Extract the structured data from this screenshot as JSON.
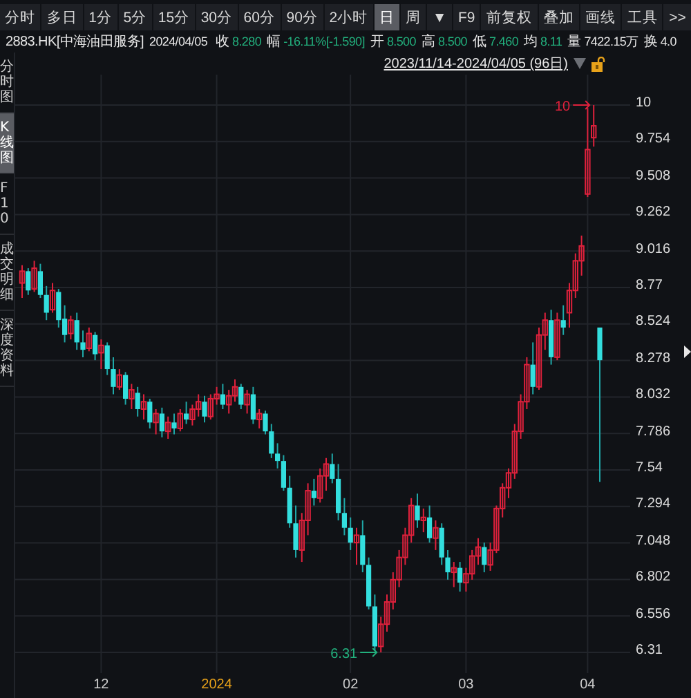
{
  "toolbar": {
    "periods": [
      {
        "label": "分时",
        "selected": false
      },
      {
        "label": "多日",
        "selected": false
      },
      {
        "label": "1分",
        "selected": false
      },
      {
        "label": "5分",
        "selected": false
      },
      {
        "label": "15分",
        "selected": false
      },
      {
        "label": "30分",
        "selected": false
      },
      {
        "label": "60分",
        "selected": false
      },
      {
        "label": "90分",
        "selected": false
      },
      {
        "label": "2小时",
        "selected": false
      },
      {
        "label": "日",
        "selected": true
      },
      {
        "label": "周",
        "selected": false
      }
    ],
    "dropdown": "▼",
    "tools": [
      "F9",
      "前复权",
      "叠加",
      "画线",
      "工具"
    ],
    "more": ">>"
  },
  "quote": {
    "symbol": "2883.HK[中海油田服务]",
    "date": "2024/04/05",
    "fields": [
      {
        "label": "收",
        "value": "8.280",
        "color": "#22b07d"
      },
      {
        "label": "幅",
        "value": "-16.11%[-1.590]",
        "color": "#22b07d"
      },
      {
        "label": "开",
        "value": "8.500",
        "color": "#22b07d"
      },
      {
        "label": "高",
        "value": "8.500",
        "color": "#22b07d"
      },
      {
        "label": "低",
        "value": "7.460",
        "color": "#22b07d"
      },
      {
        "label": "均",
        "value": "8.11",
        "color": "#22b07d"
      },
      {
        "label": "量",
        "value": "7422.15万",
        "color": "#e6e6e6"
      },
      {
        "label": "换",
        "value": "4.0",
        "color": "#e6e6e6"
      }
    ]
  },
  "sidebar": {
    "tabs": [
      {
        "label": "分时图",
        "selected": false
      },
      {
        "label": "K线图",
        "selected": true
      },
      {
        "label": "F10",
        "selected": false
      },
      {
        "label": "成交明细",
        "selected": false
      },
      {
        "label": "深度资料",
        "selected": false
      }
    ]
  },
  "chart": {
    "range": "2023/11/14-2024/04/05 (96日)",
    "tick_kinds": [
      {
        "kind": "month"
      },
      {
        "kind": "year"
      },
      {
        "kind": "month"
      },
      {
        "kind": "month"
      },
      {
        "kind": "month"
      }
    ],
    "high_marker": "10",
    "low_marker": "6.31",
    "chart_data": {
      "type": "candlestick",
      "categories": [
        null,
        null,
        null,
        null,
        null,
        null,
        null,
        null,
        null,
        null,
        null,
        null,
        null,
        "12",
        null,
        null,
        null,
        null,
        null,
        null,
        null,
        null,
        null,
        null,
        null,
        null,
        null,
        null,
        null,
        null,
        null,
        null,
        "2024",
        null,
        null,
        null,
        null,
        null,
        null,
        null,
        null,
        null,
        null,
        null,
        null,
        null,
        null,
        null,
        null,
        null,
        null,
        null,
        null,
        null,
        "02",
        null,
        null,
        null,
        null,
        null,
        null,
        null,
        null,
        null,
        null,
        null,
        null,
        null,
        null,
        null,
        null,
        null,
        null,
        "03",
        null,
        null,
        null,
        null,
        null,
        null,
        null,
        null,
        null,
        null,
        null,
        null,
        null,
        null,
        null,
        null,
        null,
        null,
        null,
        "04",
        null,
        null
      ],
      "ohlc": [
        [
          8.8,
          8.92,
          8.7,
          8.88
        ],
        [
          8.88,
          8.9,
          8.72,
          8.75
        ],
        [
          8.76,
          8.95,
          8.74,
          8.9
        ],
        [
          8.88,
          8.93,
          8.7,
          8.72
        ],
        [
          8.72,
          8.78,
          8.55,
          8.6
        ],
        [
          8.62,
          8.8,
          8.6,
          8.75
        ],
        [
          8.74,
          8.76,
          8.5,
          8.55
        ],
        [
          8.56,
          8.65,
          8.4,
          8.45
        ],
        [
          8.46,
          8.58,
          8.42,
          8.55
        ],
        [
          8.55,
          8.6,
          8.35,
          8.4
        ],
        [
          8.4,
          8.48,
          8.3,
          8.35
        ],
        [
          8.36,
          8.5,
          8.34,
          8.46
        ],
        [
          8.45,
          8.47,
          8.28,
          8.32
        ],
        [
          8.33,
          8.42,
          8.22,
          8.38
        ],
        [
          8.38,
          8.4,
          8.18,
          8.22
        ],
        [
          8.22,
          8.3,
          8.05,
          8.1
        ],
        [
          8.1,
          8.22,
          8.08,
          8.18
        ],
        [
          8.18,
          8.2,
          7.98,
          8.02
        ],
        [
          8.02,
          8.12,
          7.95,
          8.08
        ],
        [
          8.06,
          8.1,
          7.9,
          7.95
        ],
        [
          7.95,
          8.05,
          7.88,
          8.0
        ],
        [
          8.0,
          8.02,
          7.82,
          7.86
        ],
        [
          7.86,
          7.95,
          7.78,
          7.92
        ],
        [
          7.92,
          7.96,
          7.76,
          7.8
        ],
        [
          7.8,
          7.9,
          7.75,
          7.86
        ],
        [
          7.86,
          7.92,
          7.78,
          7.82
        ],
        [
          7.82,
          7.95,
          7.8,
          7.92
        ],
        [
          7.92,
          8.0,
          7.85,
          7.88
        ],
        [
          7.88,
          7.98,
          7.84,
          7.95
        ],
        [
          7.95,
          8.05,
          7.9,
          8.0
        ],
        [
          8.0,
          8.04,
          7.86,
          7.9
        ],
        [
          7.9,
          8.05,
          7.88,
          8.02
        ],
        [
          8.02,
          8.1,
          7.98,
          8.05
        ],
        [
          8.05,
          8.12,
          7.95,
          7.98
        ],
        [
          7.98,
          8.08,
          7.92,
          8.04
        ],
        [
          8.04,
          8.15,
          8.0,
          8.1
        ],
        [
          8.1,
          8.12,
          7.95,
          7.98
        ],
        [
          7.98,
          8.08,
          7.92,
          8.05
        ],
        [
          8.05,
          8.1,
          7.85,
          7.88
        ],
        [
          7.88,
          7.95,
          7.82,
          7.92
        ],
        [
          7.92,
          7.94,
          7.78,
          7.8
        ],
        [
          7.8,
          7.85,
          7.62,
          7.65
        ],
        [
          7.65,
          7.72,
          7.55,
          7.6
        ],
        [
          7.6,
          7.64,
          7.4,
          7.42
        ],
        [
          7.42,
          7.5,
          7.15,
          7.18
        ],
        [
          7.18,
          7.3,
          6.95,
          7.0
        ],
        [
          7.0,
          7.25,
          6.92,
          7.2
        ],
        [
          7.2,
          7.45,
          7.1,
          7.4
        ],
        [
          7.4,
          7.48,
          7.3,
          7.35
        ],
        [
          7.35,
          7.55,
          7.32,
          7.5
        ],
        [
          7.5,
          7.62,
          7.4,
          7.58
        ],
        [
          7.58,
          7.65,
          7.45,
          7.48
        ],
        [
          7.48,
          7.58,
          7.2,
          7.25
        ],
        [
          7.25,
          7.35,
          7.1,
          7.15
        ],
        [
          7.15,
          7.22,
          7.0,
          7.05
        ],
        [
          7.05,
          7.15,
          6.9,
          7.1
        ],
        [
          7.1,
          7.2,
          6.85,
          6.9
        ],
        [
          6.9,
          6.95,
          6.6,
          6.62
        ],
        [
          6.62,
          6.7,
          6.32,
          6.35
        ],
        [
          6.35,
          6.55,
          6.31,
          6.5
        ],
        [
          6.5,
          6.7,
          6.45,
          6.65
        ],
        [
          6.65,
          6.85,
          6.6,
          6.8
        ],
        [
          6.8,
          7.0,
          6.75,
          6.95
        ],
        [
          6.95,
          7.15,
          6.9,
          7.1
        ],
        [
          7.1,
          7.35,
          7.05,
          7.3
        ],
        [
          7.3,
          7.38,
          7.15,
          7.2
        ],
        [
          7.2,
          7.28,
          7.12,
          7.22
        ],
        [
          7.22,
          7.3,
          7.05,
          7.08
        ],
        [
          7.08,
          7.2,
          7.0,
          7.15
        ],
        [
          7.15,
          7.18,
          6.9,
          6.95
        ],
        [
          6.95,
          7.0,
          6.8,
          6.85
        ],
        [
          6.85,
          6.92,
          6.75,
          6.88
        ],
        [
          6.88,
          6.92,
          6.72,
          6.78
        ],
        [
          6.78,
          6.88,
          6.72,
          6.84
        ],
        [
          6.84,
          7.0,
          6.8,
          6.96
        ],
        [
          6.96,
          7.08,
          6.9,
          7.02
        ],
        [
          7.02,
          7.05,
          6.85,
          6.9
        ],
        [
          6.9,
          7.05,
          6.86,
          7.0
        ],
        [
          7.0,
          7.3,
          6.98,
          7.28
        ],
        [
          7.28,
          7.45,
          7.22,
          7.42
        ],
        [
          7.42,
          7.55,
          7.35,
          7.52
        ],
        [
          7.52,
          7.85,
          7.48,
          7.8
        ],
        [
          7.8,
          8.05,
          7.75,
          8.0
        ],
        [
          8.0,
          8.3,
          7.95,
          8.25
        ],
        [
          8.25,
          8.4,
          8.05,
          8.1
        ],
        [
          8.1,
          8.5,
          8.08,
          8.45
        ],
        [
          8.45,
          8.6,
          8.35,
          8.55
        ],
        [
          8.55,
          8.62,
          8.25,
          8.3
        ],
        [
          8.3,
          8.6,
          8.28,
          8.55
        ],
        [
          8.55,
          8.65,
          8.45,
          8.5
        ],
        [
          8.6,
          8.8,
          8.5,
          8.75
        ],
        [
          8.75,
          9.0,
          8.7,
          8.95
        ],
        [
          8.95,
          9.12,
          8.85,
          9.05
        ],
        [
          9.4,
          9.98,
          9.38,
          9.7
        ],
        [
          9.78,
          10.0,
          9.72,
          9.86
        ],
        [
          8.5,
          8.5,
          7.46,
          8.28
        ]
      ],
      "ylim": [
        6.31,
        10
      ],
      "grid": true,
      "yticks": [
        10,
        9.754,
        9.508,
        9.262,
        9.016,
        8.77,
        8.524,
        8.278,
        8.032,
        7.786,
        7.54,
        7.294,
        7.048,
        6.802,
        6.556,
        6.31
      ]
    }
  }
}
